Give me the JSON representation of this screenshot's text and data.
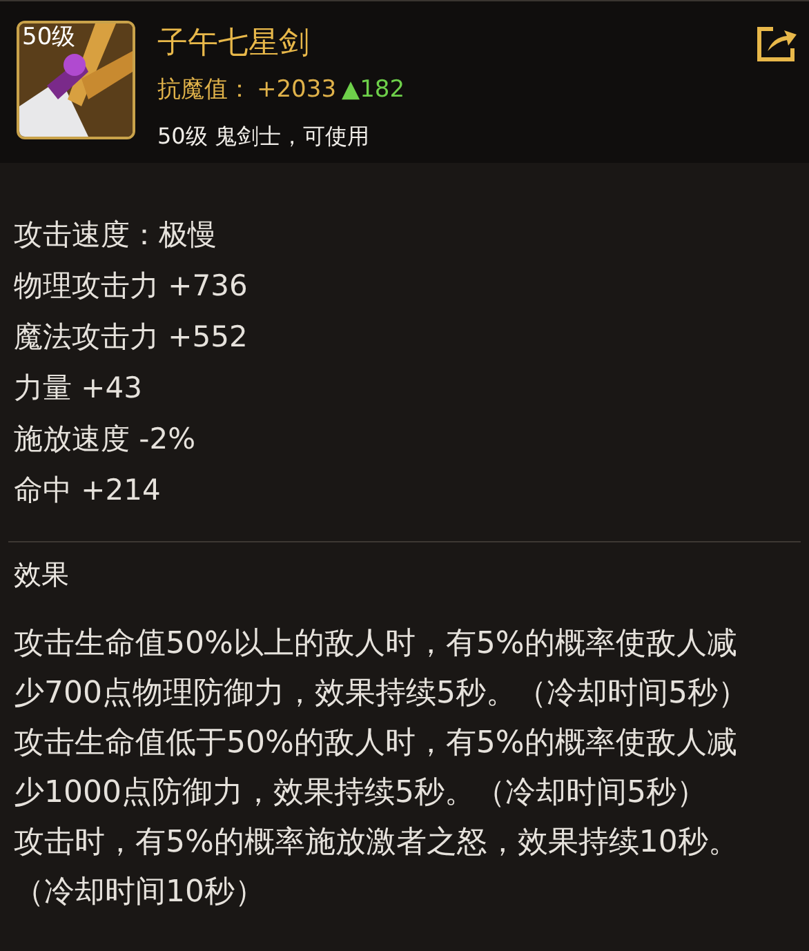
{
  "item": {
    "level_badge": "50级",
    "name": "子午七星剑",
    "stat_label": "抗魔值：",
    "stat_value": "+2033",
    "stat_change": "▲182",
    "requirement": "50级 鬼剑士，可使用"
  },
  "stats": [
    "攻击速度：极慢",
    "物理攻击力 +736",
    "魔法攻击力 +552",
    "力量 +43",
    "施放速度 -2%",
    "命中 +214"
  ],
  "effects": {
    "title": "效果",
    "items": [
      "攻击生命值50%以上的敌人时，有5%的概率使敌人减少700点物理防御力，效果持续5秒。（冷却时间5秒）",
      "攻击生命值低于50%的敌人时，有5%的概率使敌人减少1000点防御力，效果持续5秒。（冷却时间5秒）",
      "攻击时，有5%的概率施放激者之怒，效果持续10秒。（冷却时间10秒）"
    ]
  }
}
